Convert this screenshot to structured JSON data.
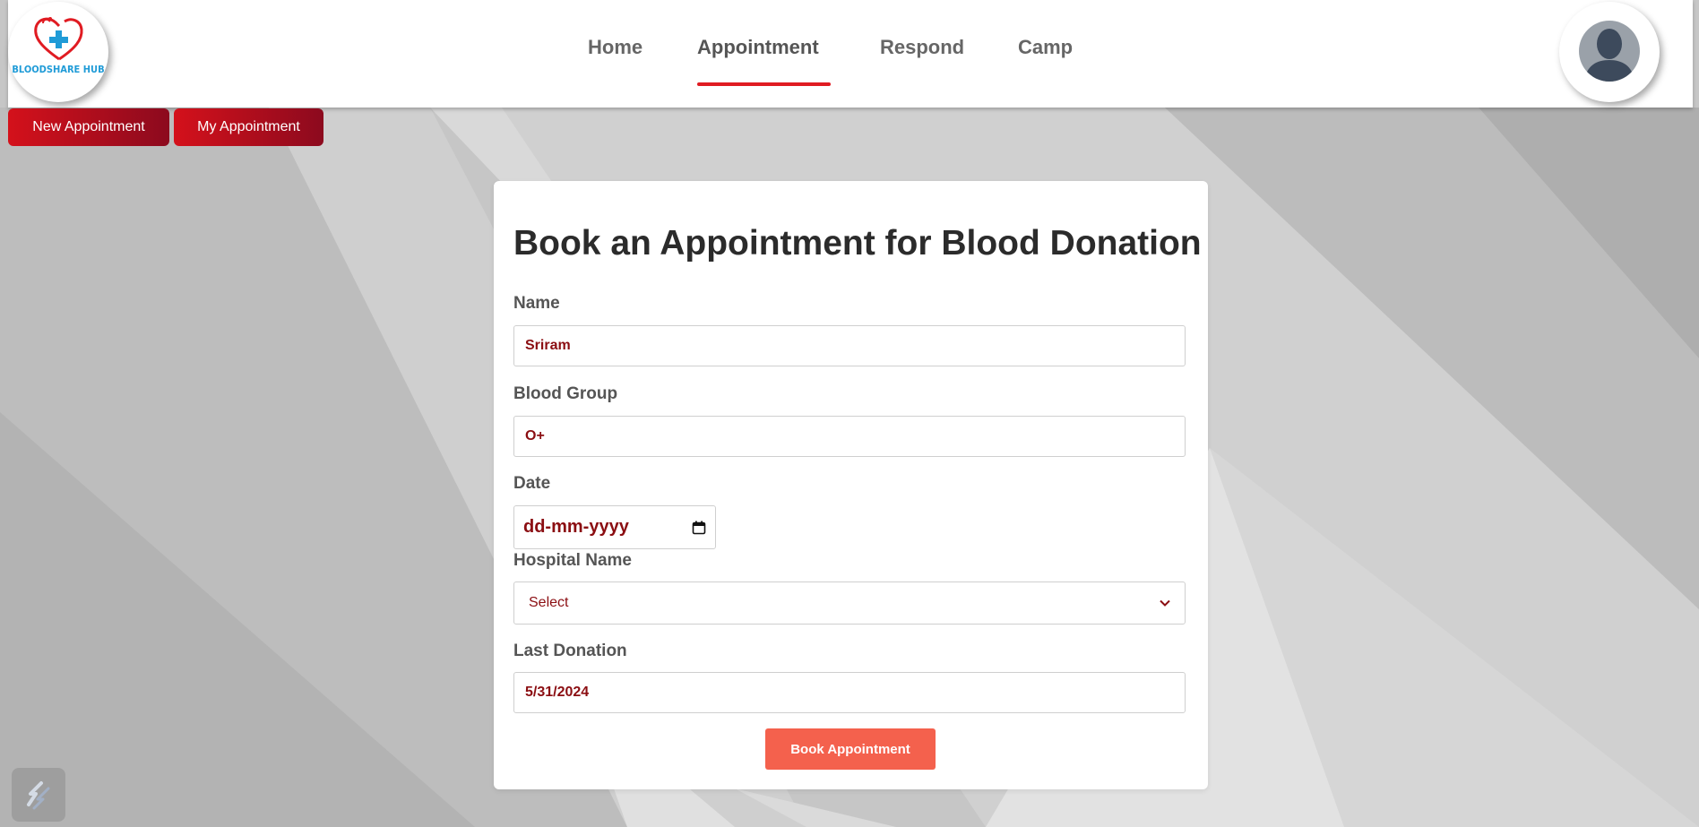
{
  "brand": {
    "logo_text": "BLOODSHARE HUB"
  },
  "nav": {
    "items": [
      {
        "label": "Home"
      },
      {
        "label": "Appointment"
      },
      {
        "label": "Respond"
      },
      {
        "label": "Camp"
      }
    ],
    "active": "Appointment"
  },
  "subnav": {
    "new_label": "New Appointment",
    "my_label": "My Appointment"
  },
  "form": {
    "title": "Book an Appointment for Blood Donation",
    "name_label": "Name",
    "name_value": "Sriram",
    "blood_group_label": "Blood Group",
    "blood_group_value": "O+",
    "date_label": "Date",
    "date_value": "dd-mm-yyyy",
    "hospital_label": "Hospital Name",
    "hospital_value": "Select",
    "last_donation_label": "Last Donation",
    "last_donation_value": "5/31/2024",
    "submit_label": "Book Appointment"
  },
  "colors": {
    "accent_red": "#e01b22",
    "button_gradient_start": "#d4111b",
    "button_gradient_end": "#8c0a1e",
    "book_button": "#f4614d",
    "field_text": "#8b0e12",
    "logo_blue": "#1f9bd7"
  },
  "icons": {
    "logo": "heart-cross-icon",
    "avatar": "user-silhouette-icon",
    "calendar": "calendar-icon",
    "dropdown": "chevron-down-icon",
    "floating": "app-switch-icon"
  }
}
